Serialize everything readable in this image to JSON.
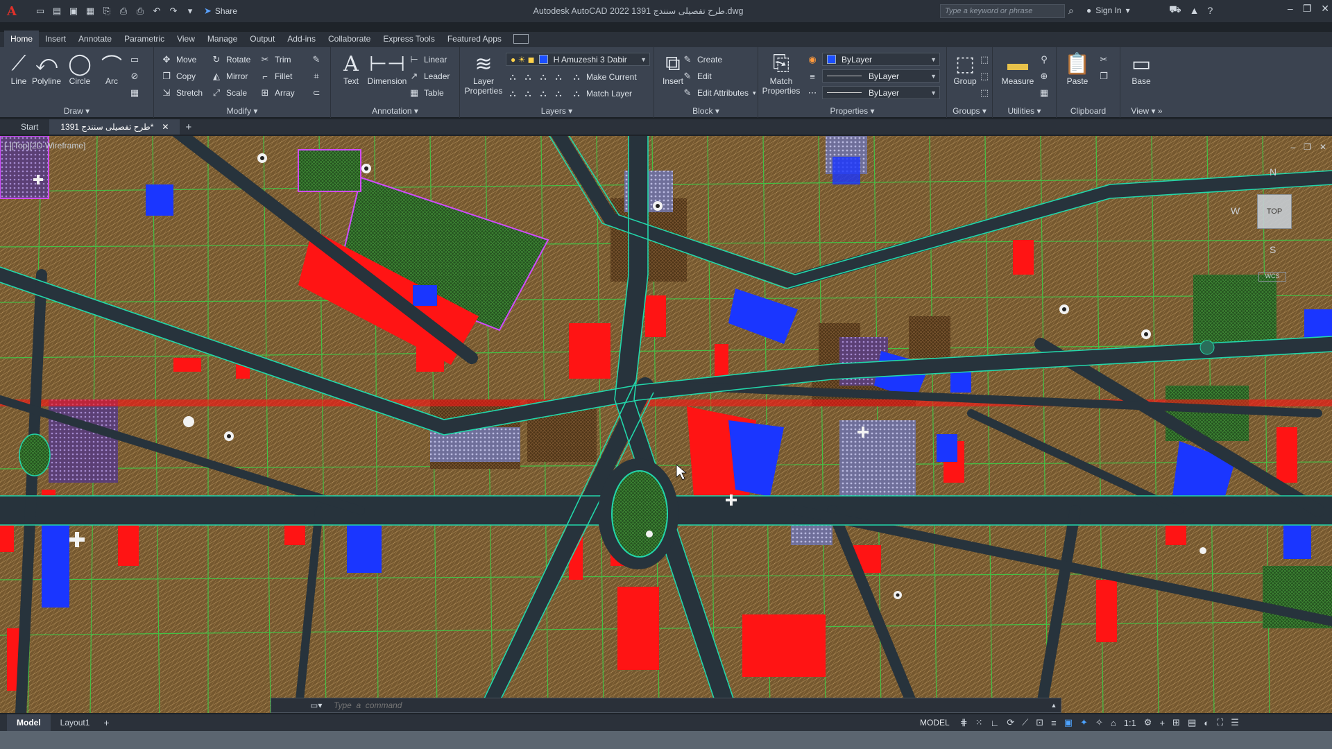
{
  "titlebar": {
    "app_logo": "A",
    "share_label": "Share",
    "window_title": "Autodesk AutoCAD 2022   1391 طرح تفصیلی سنندج.dwg",
    "search_placeholder": "Type a keyword or phrase",
    "signin_label": "Sign In"
  },
  "ribbon_tabs": [
    "Home",
    "Insert",
    "Annotate",
    "Parametric",
    "View",
    "Manage",
    "Output",
    "Add-ins",
    "Collaborate",
    "Express Tools",
    "Featured Apps"
  ],
  "ribbon": {
    "draw": {
      "label": "Draw",
      "line": "Line",
      "polyline": "Polyline",
      "circle": "Circle",
      "arc": "Arc"
    },
    "modify": {
      "label": "Modify",
      "move": "Move",
      "rotate": "Rotate",
      "trim": "Trim",
      "copy": "Copy",
      "mirror": "Mirror",
      "fillet": "Fillet",
      "stretch": "Stretch",
      "scale": "Scale",
      "array": "Array"
    },
    "annotation": {
      "label": "Annotation",
      "text": "Text",
      "dimension": "Dimension",
      "linear": "Linear",
      "leader": "Leader",
      "table": "Table"
    },
    "layers": {
      "label": "Layers",
      "layer_properties": "Layer Properties",
      "current_layer": "H Amuzeshi 3 Dabir",
      "make_current": "Make Current",
      "match_layer": "Match Layer"
    },
    "block": {
      "label": "Block",
      "insert": "Insert",
      "create": "Create",
      "edit": "Edit",
      "edit_attributes": "Edit Attributes"
    },
    "properties": {
      "label": "Properties",
      "match_properties": "Match Properties",
      "color": "ByLayer",
      "linetype": "ByLayer",
      "lineweight": "ByLayer"
    },
    "groups": {
      "label": "Groups",
      "group": "Group"
    },
    "utilities": {
      "label": "Utilities",
      "measure": "Measure"
    },
    "clipboard": {
      "label": "Clipboard",
      "paste": "Paste"
    },
    "view": {
      "label": "View",
      "base": "Base"
    }
  },
  "doc_tabs": {
    "start": "Start",
    "active": "طرح تفصیلی سنندج 1391*"
  },
  "viewport": {
    "view_label": "[-][Top][2D Wireframe]",
    "viewcube": "TOP",
    "compass_n": "N",
    "compass_w": "W",
    "compass_s": "S",
    "wcs": "WCS"
  },
  "command_line": {
    "placeholder": "Type  a  command"
  },
  "statusbar": {
    "model_tab": "Model",
    "layout_tab": "Layout1",
    "model_label": "MODEL",
    "scale": "1:1"
  },
  "colors": {
    "road": "#2a3640",
    "road_edge": "#1fd6a8",
    "parcel_lines": "#3cd24a",
    "residential": "#8a6a3a",
    "commercial": "#ff1a1a",
    "education": "#1c3cff",
    "green": "#2f6b2a",
    "religious": "#b040ff"
  }
}
